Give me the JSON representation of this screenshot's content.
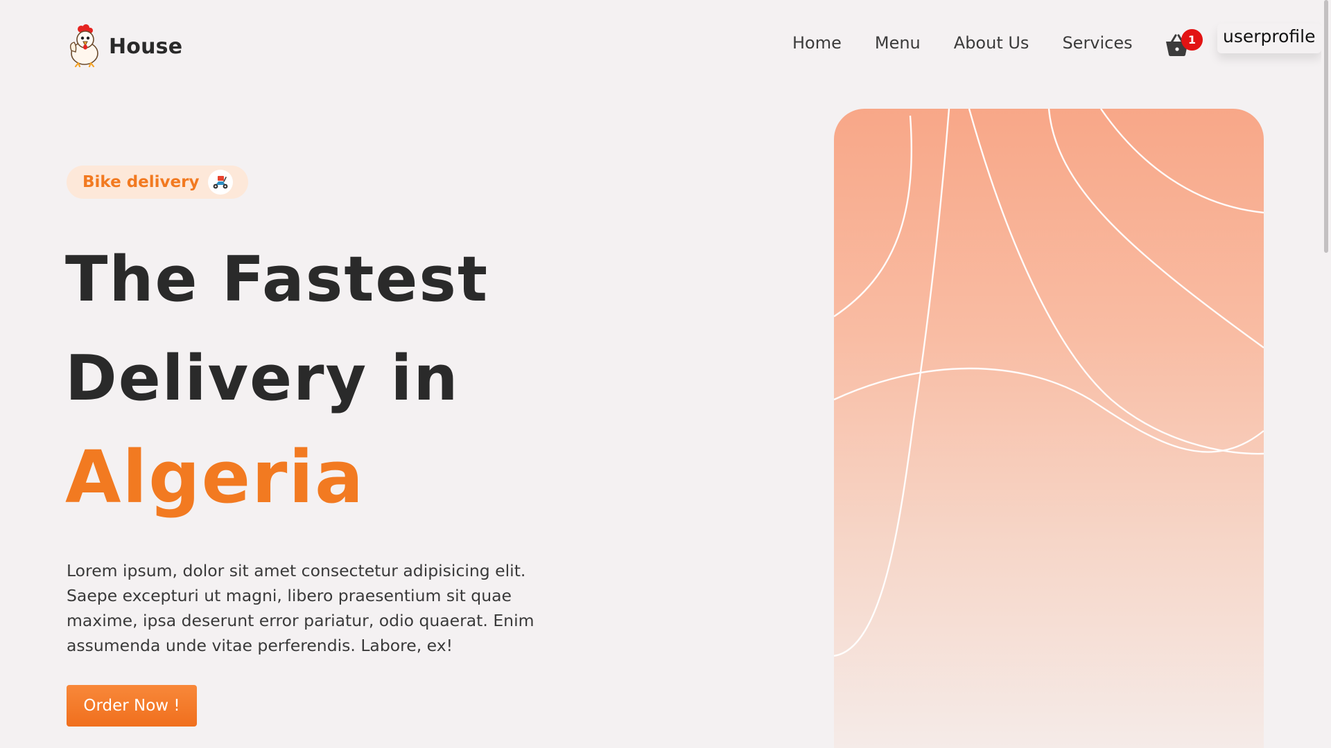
{
  "brand": {
    "name": "House",
    "logo_icon": "chicken-mascot-icon"
  },
  "nav": {
    "items": [
      {
        "label": "Home"
      },
      {
        "label": "Menu"
      },
      {
        "label": "About Us"
      },
      {
        "label": "Services"
      }
    ]
  },
  "cart": {
    "icon": "basket-icon",
    "count": "1"
  },
  "user": {
    "label": "userprofile"
  },
  "hero": {
    "badge": {
      "label": "Bike delivery",
      "icon": "scooter-icon"
    },
    "headline": {
      "line1": "The Fastest",
      "line2": "Delivery in",
      "accent": "Algeria"
    },
    "description": "Lorem ipsum, dolor sit amet consectetur adipisicing elit. Saepe excepturi ut magni, libero praesentium sit quae maxime, ipsa deserunt error pariatur, odio quaerat. Enim assumenda unde vitae perferendis. Labore, ex!",
    "cta_label": "Order Now !"
  },
  "colors": {
    "accent": "#f27a21",
    "badge_bg": "#fde8d9",
    "cart_badge": "#e21313",
    "background": "#f4f1f2",
    "text_dark": "#2a2a2a"
  }
}
